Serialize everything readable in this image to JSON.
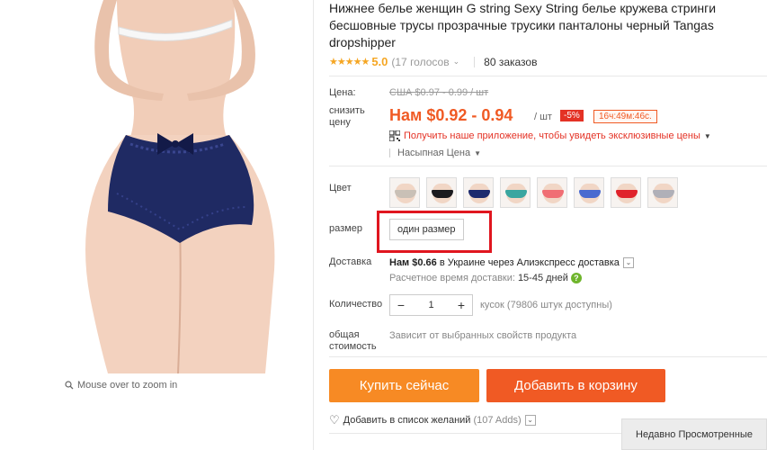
{
  "product": {
    "title": "Нижнее белье женщин G string Sexy String белье кружева стринги бесшовные трусы прозрачные трусики панталоны черный Tangas dropshipper",
    "rating_stars": "★★★★★",
    "rating_score": "5.0",
    "votes": "(17 голосов",
    "orders": "80 заказов"
  },
  "gallery": {
    "zoom_hint": "Mouse over to zoom in"
  },
  "price": {
    "price_label": "Цена:",
    "old_price": "США $0.97 - 0.99 / шт",
    "discount_label": "снизить цену",
    "current_price": "Нам $0.92 - 0.94",
    "unit": "/ шт",
    "discount_badge": "-5%",
    "timer": "16ч:49м:46с.",
    "app_promo": "Получить наше приложение, чтобы увидеть эксклюзивные цены",
    "bulk_price": "Насыпная Цена"
  },
  "options": {
    "color_label": "Цвет",
    "size_label": "размер",
    "size_value": "один размер",
    "swatches": [
      {
        "panty": "#c9c0b6",
        "name": "swatch-beige"
      },
      {
        "panty": "#1b1b1f",
        "name": "swatch-black"
      },
      {
        "panty": "#1d2a6e",
        "name": "swatch-navy"
      },
      {
        "panty": "#3aa6a0",
        "name": "swatch-teal"
      },
      {
        "panty": "#f06e74",
        "name": "swatch-pink"
      },
      {
        "panty": "#4a6ad0",
        "name": "swatch-blue"
      },
      {
        "panty": "#e0232b",
        "name": "swatch-red"
      },
      {
        "panty": "#b0b0b8",
        "name": "swatch-grey"
      }
    ]
  },
  "shipping": {
    "label": "Доставка",
    "main_bold": "Нам $0.66",
    "main_rest": " в Украине через Алиэкспресс доставка",
    "time_label": "Расчетное время доставки:",
    "time_days": "15-45 дней"
  },
  "quantity": {
    "label": "Количество",
    "minus": "−",
    "value": "1",
    "plus": "+",
    "available": "кусок (79806 штук доступны)"
  },
  "total": {
    "label": "общая стоимость",
    "value": "Зависит от выбранных свойств продукта"
  },
  "actions": {
    "buy_now": "Купить сейчас",
    "add_to_cart": "Добавить в корзину",
    "wishlist": "Добавить в список желаний",
    "wishlist_count": "(107 Adds)",
    "recently_viewed": "Недавно Просмотренные"
  },
  "colors": {
    "accent": "#f05a24",
    "buy_button": "#f78a24",
    "highlight_frame": "#e0161f",
    "star": "#f5a623"
  }
}
